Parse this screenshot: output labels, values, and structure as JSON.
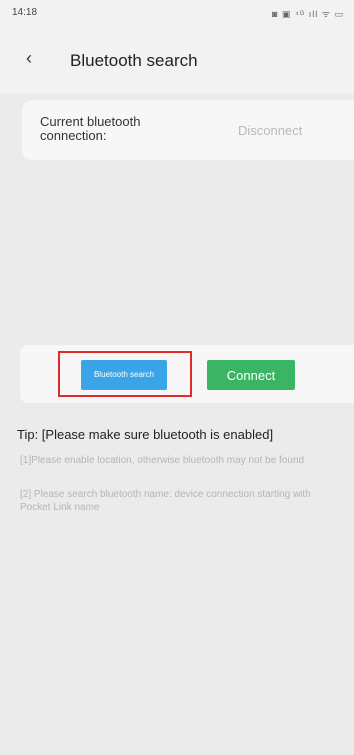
{
  "status_bar": {
    "time": "14:18",
    "icons_text": "◙ ▣ ⁴ᴳ ıll ᯤ ▭"
  },
  "header": {
    "back_icon": "‹",
    "title": "Bluetooth search"
  },
  "connection": {
    "label": "Current bluetooth connection:",
    "status": "Disconnect"
  },
  "buttons": {
    "search_label": "Bluetooth search",
    "connect_label": "Connect",
    "highlight_color": "#e02b2b",
    "search_color": "#3aa4e8",
    "connect_color": "#3bb563"
  },
  "tip": {
    "title": "Tip: [Please make sure bluetooth is enabled]",
    "lines": [
      "[1]Please enable location, otherwise bluetooth may not be found",
      "[2] Please search bluetooth name: device connection starting with Pocket Link name"
    ]
  }
}
